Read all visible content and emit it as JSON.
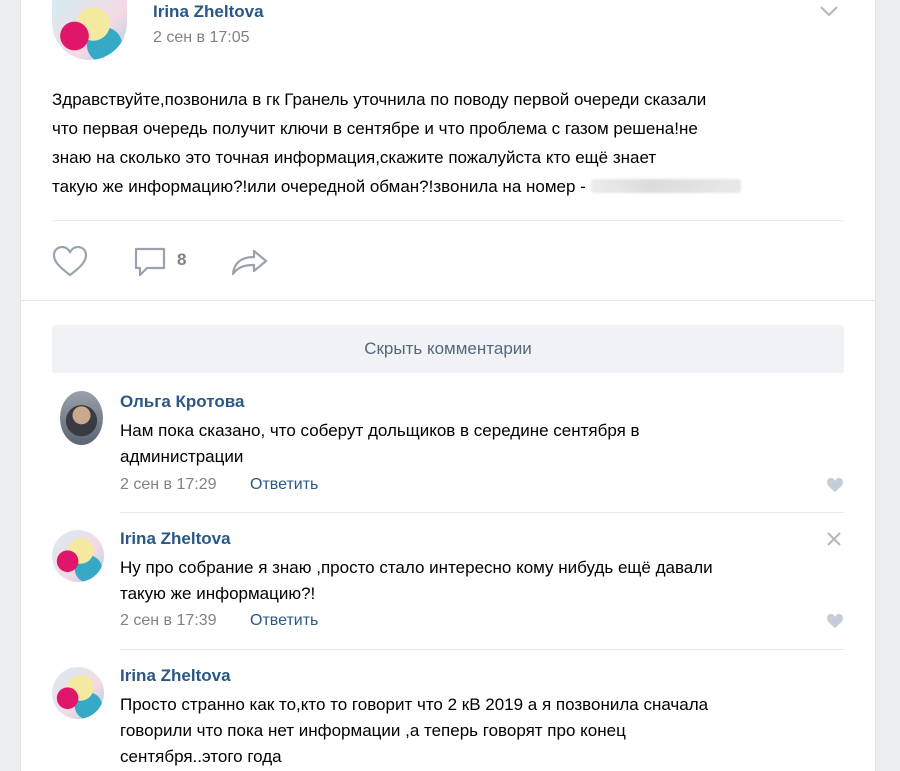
{
  "post": {
    "author": "Irina Zheltova",
    "date": "2 сен в 17:05",
    "text_lines": [
      "Здравствуйте,позвонила в гк Гранель уточнила по поводу первой очереди сказали",
      "что первая очередь получит ключи в сентябре и что проблема с газом решена!не",
      "знаю на сколько это точная информация,скажите пожалуйста кто ещё знает",
      "такую же информацию?!или очередной обман?!звонила на номер -"
    ],
    "comments_count": "8",
    "icons": {
      "like": "heart-icon",
      "comment": "comment-icon",
      "share": "share-arrow-icon",
      "menu": "chevron-down-icon"
    }
  },
  "comments_toggle": "Скрыть комментарии",
  "reply_label": "Ответить",
  "comments": [
    {
      "author": "Ольга Кротова",
      "text_lines": [
        "Нам пока сказано, что соберут дольщиков в середине сентября в",
        "администрации"
      ],
      "date": "2 сен в 17:29"
    },
    {
      "author": "Irina Zheltova",
      "text_lines": [
        "Ну про собрание я знаю ,просто стало интересно кому нибудь ещё давали",
        "такую же информацию?!"
      ],
      "date": "2 сен в 17:39"
    },
    {
      "author": "Irina Zheltova",
      "text_lines": [
        "Просто странно как то,кто то говорит что 2 кВ 2019 а я позвонила сначала",
        "говорили что пока нет информации ,а теперь говорят про конец",
        "сентября..этого года"
      ]
    }
  ],
  "colors": {
    "link": "#2a5885",
    "meta": "#828282",
    "icon": "#99a2ad",
    "toggle_bg": "#f0f2f5"
  }
}
